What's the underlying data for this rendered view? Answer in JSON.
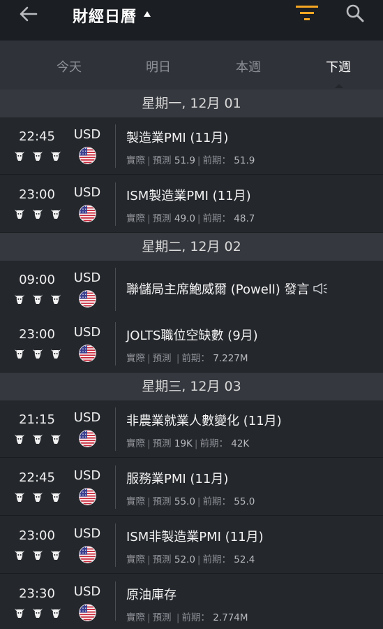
{
  "topbar": {
    "title": "財經日曆"
  },
  "tabs": [
    {
      "label": "今天",
      "active": false
    },
    {
      "label": "明日",
      "active": false
    },
    {
      "label": "本週",
      "active": false
    },
    {
      "label": "下週",
      "active": true
    }
  ],
  "labels": {
    "actual": "實際",
    "forecast": "預測",
    "previous": "前期："
  },
  "days": [
    {
      "header": "星期一, 12月 01"
    },
    {
      "header": "星期二, 12月 02"
    },
    {
      "header": "星期三, 12月 03"
    }
  ],
  "events": [
    {
      "time": "22:45",
      "currency": "USD",
      "name": "製造業PMI (11月)",
      "forecast": "51.9",
      "previous": "51.9"
    },
    {
      "time": "23:00",
      "currency": "USD",
      "name": "ISM製造業PMI (11月)",
      "forecast": "49.0",
      "previous": "48.7"
    },
    {
      "time": "09:00",
      "currency": "USD",
      "name": "聯儲局主席鮑威爾 (Powell) 發言"
    },
    {
      "time": "23:00",
      "currency": "USD",
      "name": "JOLTS職位空缺數 (9月)",
      "forecast": "",
      "previous": "7.227M"
    },
    {
      "time": "21:15",
      "currency": "USD",
      "name": "非農業就業人數變化 (11月)",
      "forecast": "19K",
      "previous": "42K"
    },
    {
      "time": "22:45",
      "currency": "USD",
      "name": "服務業PMI (11月)",
      "forecast": "55.0",
      "previous": "55.0"
    },
    {
      "time": "23:00",
      "currency": "USD",
      "name": "ISM非製造業PMI (11月)",
      "forecast": "52.0",
      "previous": "52.4"
    },
    {
      "time": "23:30",
      "currency": "USD",
      "name": "原油庫存",
      "forecast": "",
      "previous": "2.774M"
    }
  ],
  "colors": {
    "accent": "#f5a623",
    "background": "#24272c",
    "header": "#35383e"
  },
  "icons": {
    "back": "arrow-left-icon",
    "filter": "filter-icon",
    "search": "search-icon",
    "importance": "bull-icon",
    "flag": "us-flag-icon",
    "speaker": "megaphone-icon"
  }
}
